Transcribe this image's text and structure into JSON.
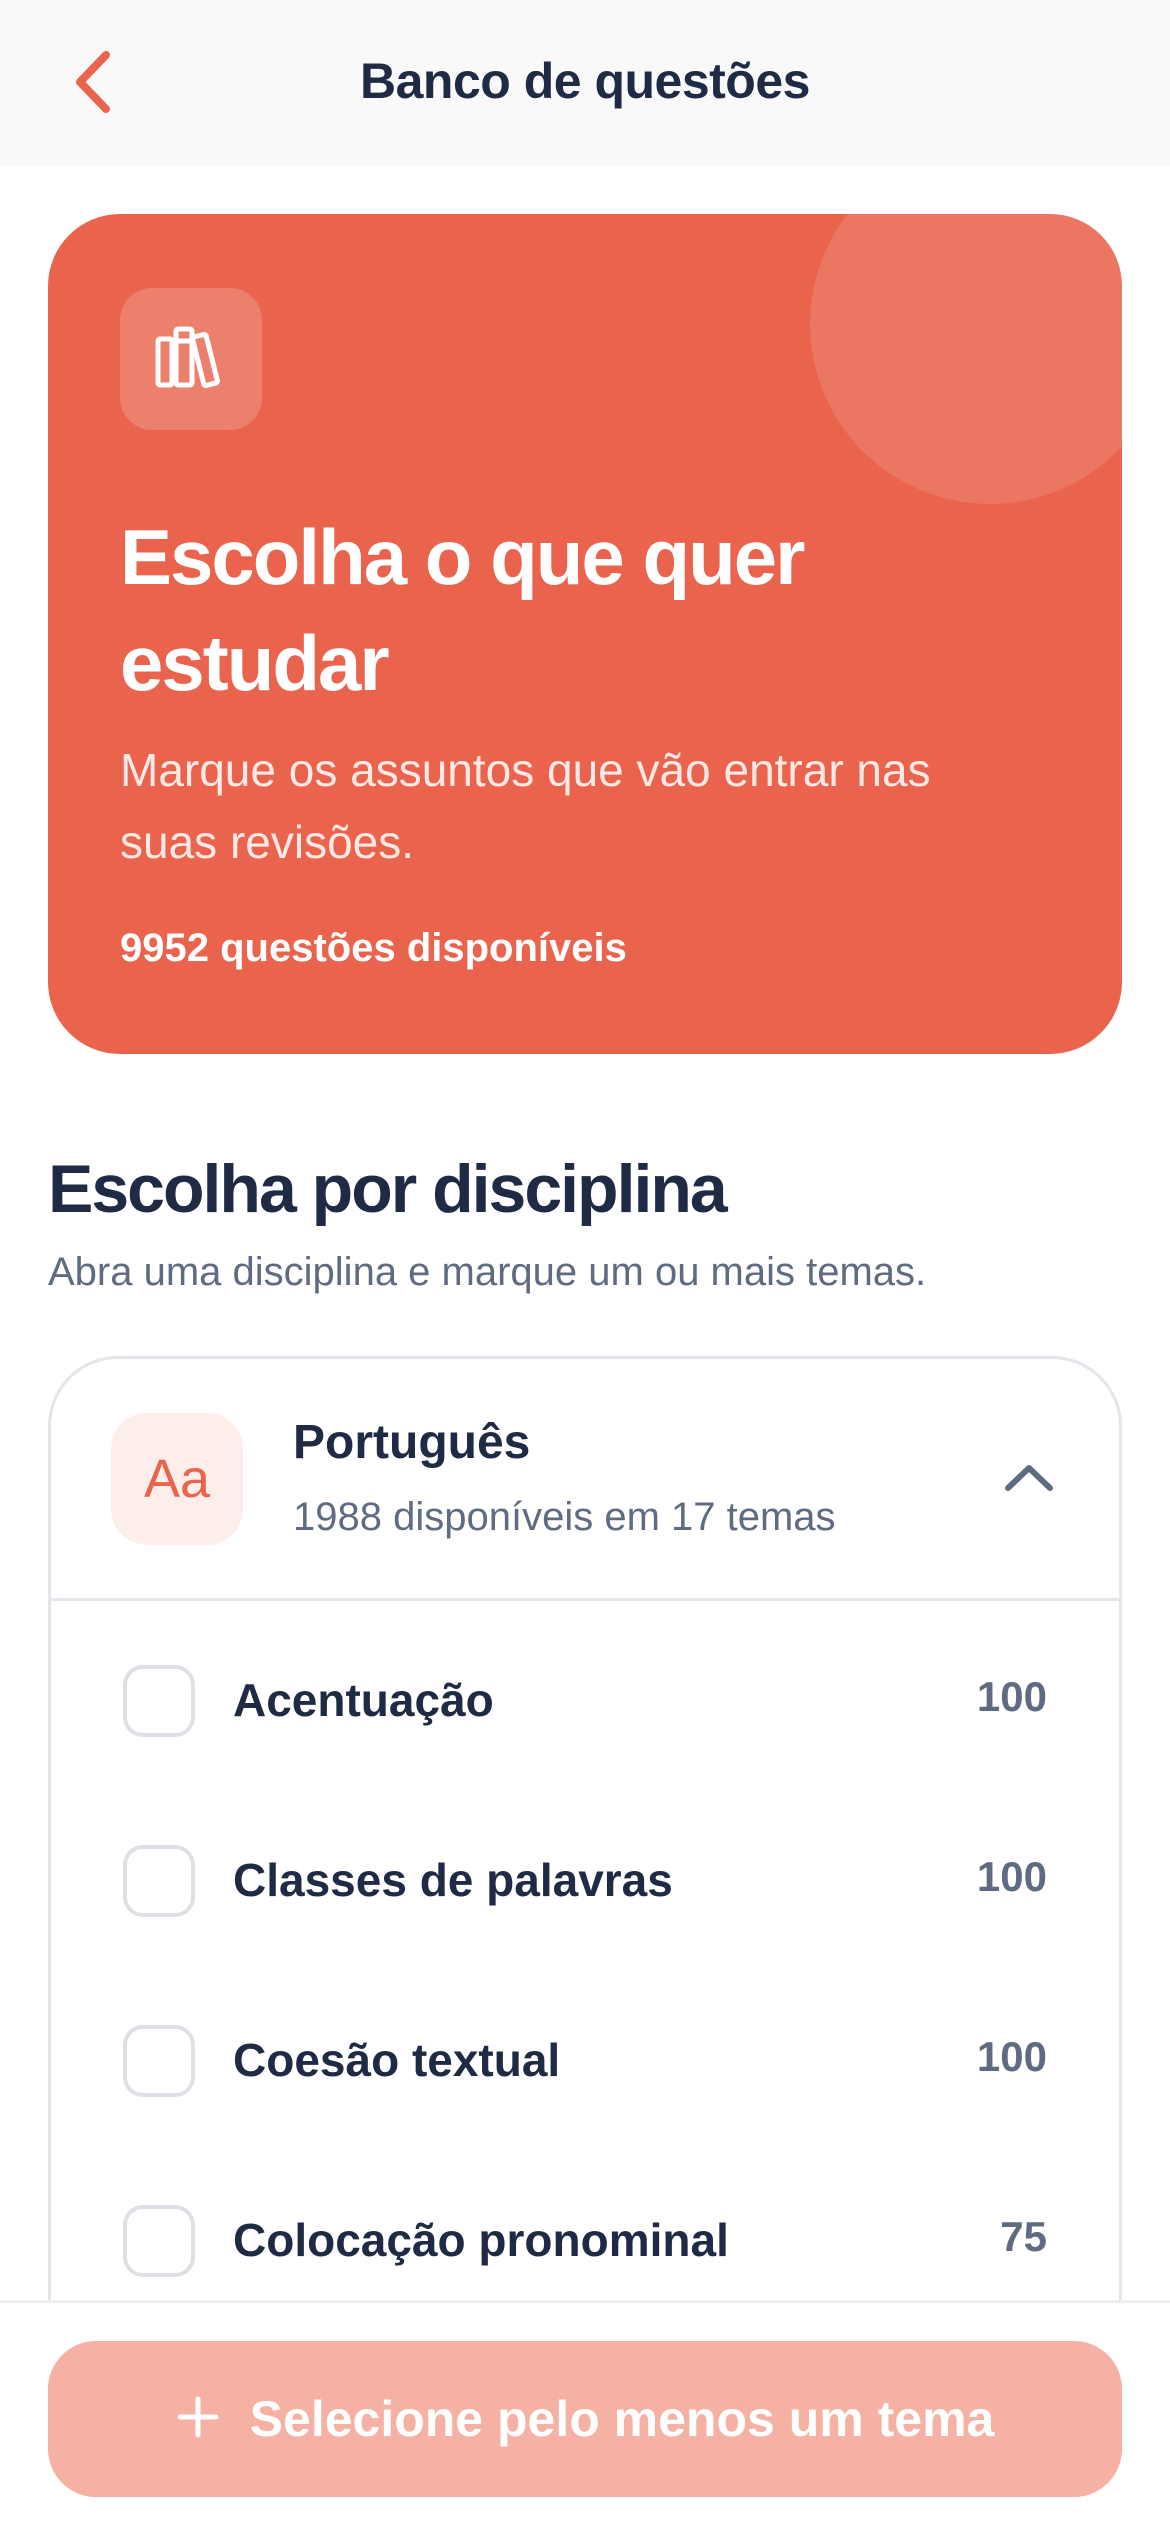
{
  "header": {
    "title": "Banco de questões",
    "back_icon": "chevron-left-icon"
  },
  "hero": {
    "icon": "books-icon",
    "title": "Escolha o que quer estudar",
    "subtitle": "Marque os assuntos que vão entrar nas suas revisões.",
    "count_text": "9952 questões disponíveis"
  },
  "section": {
    "title": "Escolha por disciplina",
    "subtitle": "Abra uma disciplina e marque um ou mais temas."
  },
  "discipline": {
    "avatar": "Aa",
    "name": "Português",
    "meta": "1988 disponíveis em 17 temas",
    "expanded": true,
    "topics": [
      {
        "label": "Acentuação",
        "count": "100",
        "checked": false
      },
      {
        "label": "Classes de palavras",
        "count": "100",
        "checked": false
      },
      {
        "label": "Coesão textual",
        "count": "100",
        "checked": false
      },
      {
        "label": "Colocação pronominal",
        "count": "75",
        "checked": false
      }
    ]
  },
  "cta": {
    "label": "Selecione pelo menos um tema",
    "icon": "plus-icon"
  },
  "colors": {
    "accent": "#e9634d",
    "text_dark": "#1f2a44",
    "text_muted": "#5f6b80",
    "cta_disabled": "#f4b1a4"
  }
}
